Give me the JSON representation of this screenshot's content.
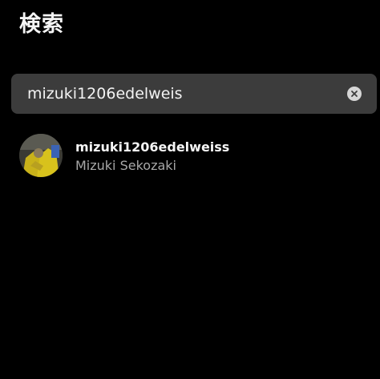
{
  "header": {
    "title": "検索"
  },
  "search": {
    "value": "mizuki1206edelweis",
    "clear_icon": "clear-icon"
  },
  "results": [
    {
      "username": "mizuki1206edelweiss",
      "display_name": "Mizuki Sekozaki",
      "avatar_icon": "profile-photo"
    }
  ],
  "colors": {
    "background": "#000000",
    "search_box": "#3c3c3c",
    "primary_text": "#f5f5f5",
    "secondary_text": "#a8a8a8"
  }
}
